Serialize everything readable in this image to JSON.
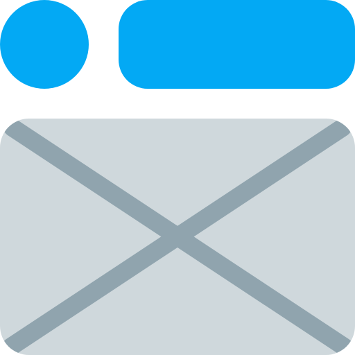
{
  "icon": {
    "name": "wireframe-layout-icon",
    "colors": {
      "avatar": "#03A9F4",
      "title_bar": "#03A9F4",
      "image_placeholder_fill": "#CFD8DC",
      "image_placeholder_cross": "#90A4AE",
      "background": "#FFFFFF"
    }
  }
}
